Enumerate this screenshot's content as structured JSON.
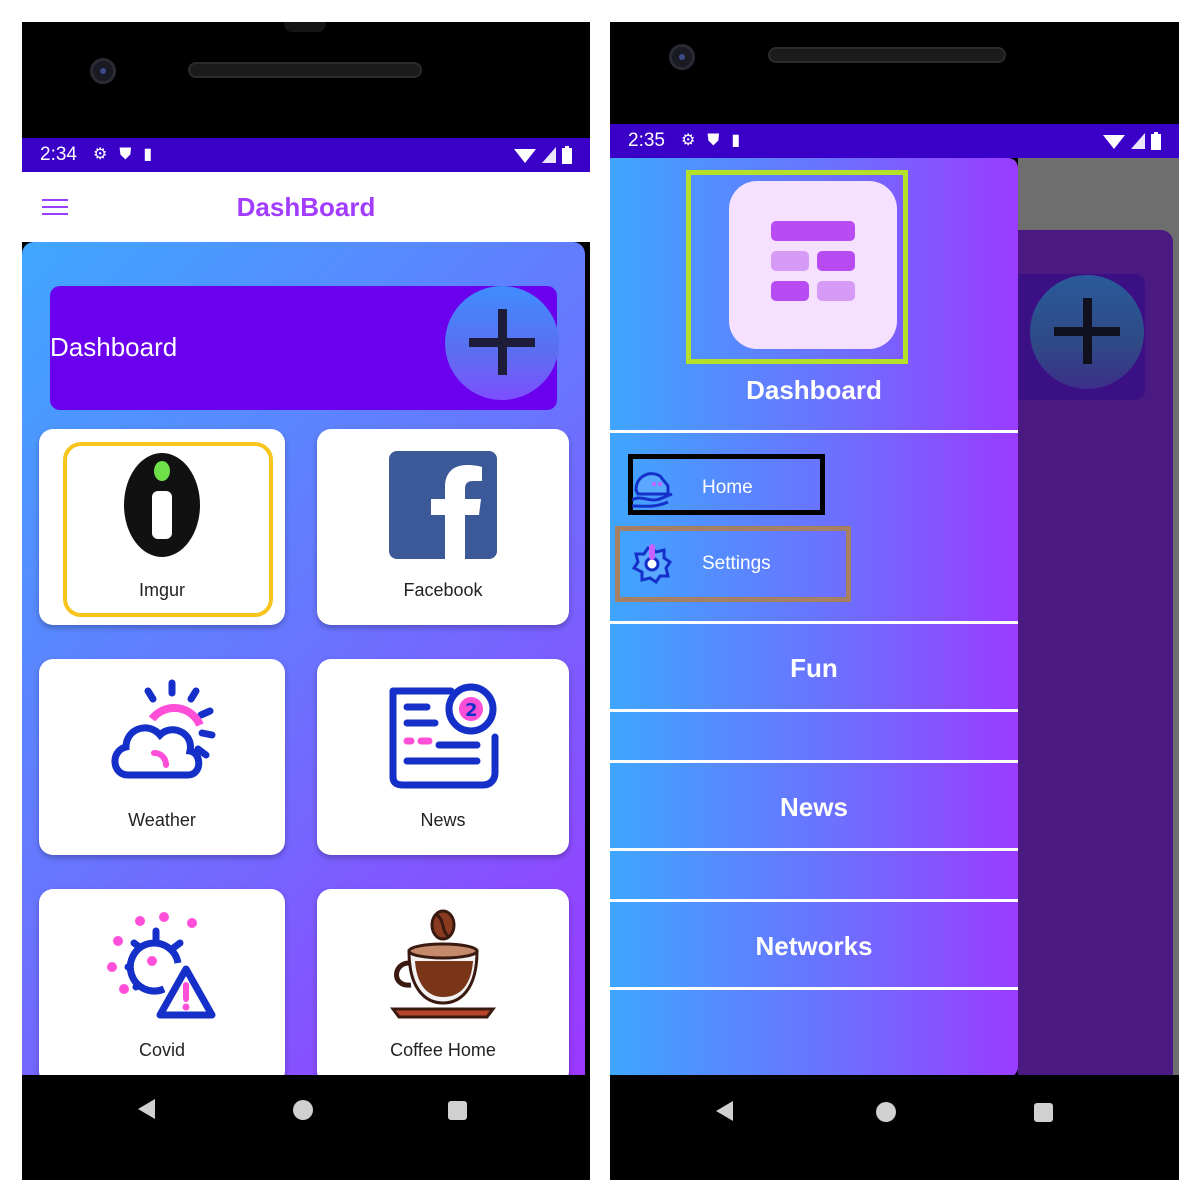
{
  "left": {
    "status": {
      "time": "2:34"
    },
    "appbar": {
      "title": "DashBoard"
    },
    "banner": {
      "label": "Dashboard"
    },
    "cards": [
      {
        "label": "Imgur",
        "icon": "imgur-icon"
      },
      {
        "label": "Facebook",
        "icon": "facebook-icon"
      },
      {
        "label": "Weather",
        "icon": "weather-icon"
      },
      {
        "label": "News",
        "icon": "news-icon"
      },
      {
        "label": "Covid",
        "icon": "covid-icon"
      },
      {
        "label": "Coffee Home",
        "icon": "coffee-icon"
      }
    ]
  },
  "right": {
    "status": {
      "time": "2:35"
    },
    "drawer": {
      "title": "Dashboard",
      "items": [
        {
          "label": "Home",
          "icon": "home-icon"
        },
        {
          "label": "Settings",
          "icon": "settings-icon"
        }
      ],
      "sections": [
        "Fun",
        "News",
        "Networks"
      ]
    }
  },
  "colors": {
    "status_bar": "#3a00c8",
    "accent": "#a23cff",
    "banner": "#6a00ee",
    "highlight_imgur": "#f7c51c",
    "highlight_logo": "#b4e02a",
    "highlight_home": "#000000",
    "highlight_settings": "#a58064"
  }
}
